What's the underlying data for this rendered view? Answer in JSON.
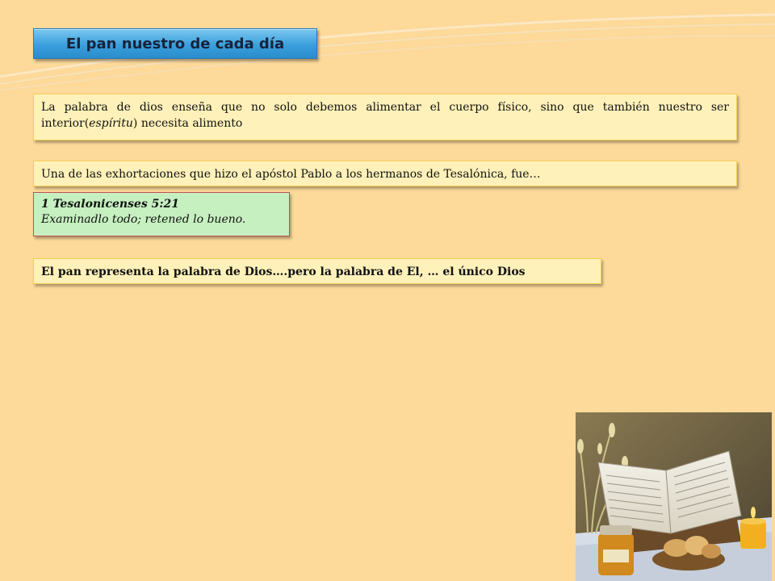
{
  "slide": {
    "title": "El pan nuestro de cada día",
    "paragraph1": {
      "before": "La palabra de dios enseña que no solo debemos alimentar el cuerpo físico, sino que también nuestro ser interior(",
      "italic": "espíritu",
      "after": ") necesita alimento"
    },
    "paragraph2": "Una de las exhortaciones que hizo el apóstol Pablo a los hermanos de Tesalónica, fue…",
    "verse": {
      "reference": "1 Tesalonicenses 5:21",
      "text": "Examinadlo todo; retened lo bueno."
    },
    "paragraph3": "El pan representa la palabra de Dios….pero la palabra de El, … el único Dios"
  },
  "photo": {
    "description": "open-bible-bread-candle-photo"
  },
  "colors": {
    "background": "#fdd99a",
    "title_blue": "#3a9fdc",
    "text_box": "#fff1b9",
    "verse_box": "#c6f0c0"
  }
}
